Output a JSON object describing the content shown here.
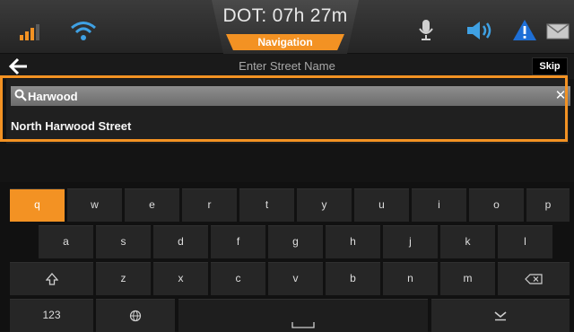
{
  "status_bar": {
    "dot_time": "DOT: 07h 27m",
    "mode_label": "Navigation",
    "icons": [
      "signal-icon",
      "wifi-icon",
      "microphone-icon",
      "volume-icon",
      "alert-icon",
      "mail-icon"
    ],
    "colors": {
      "accent": "#f39223",
      "signal": "#f39223",
      "wifi": "#3fa1e4",
      "alert": "#1e6fd6"
    }
  },
  "header": {
    "title": "Enter Street Name",
    "skip_label": "Skip"
  },
  "search": {
    "value": "Harwood",
    "clear_label": "✕",
    "suggestions": [
      "North Harwood Street"
    ]
  },
  "keyboard": {
    "row1": [
      "q",
      "w",
      "e",
      "r",
      "t",
      "y",
      "u",
      "i",
      "o",
      "p"
    ],
    "row2": [
      "a",
      "s",
      "d",
      "f",
      "g",
      "h",
      "j",
      "k",
      "l"
    ],
    "row3": [
      "z",
      "x",
      "c",
      "v",
      "b",
      "n",
      "m"
    ],
    "numbers_label": "123",
    "active_key": "q"
  }
}
